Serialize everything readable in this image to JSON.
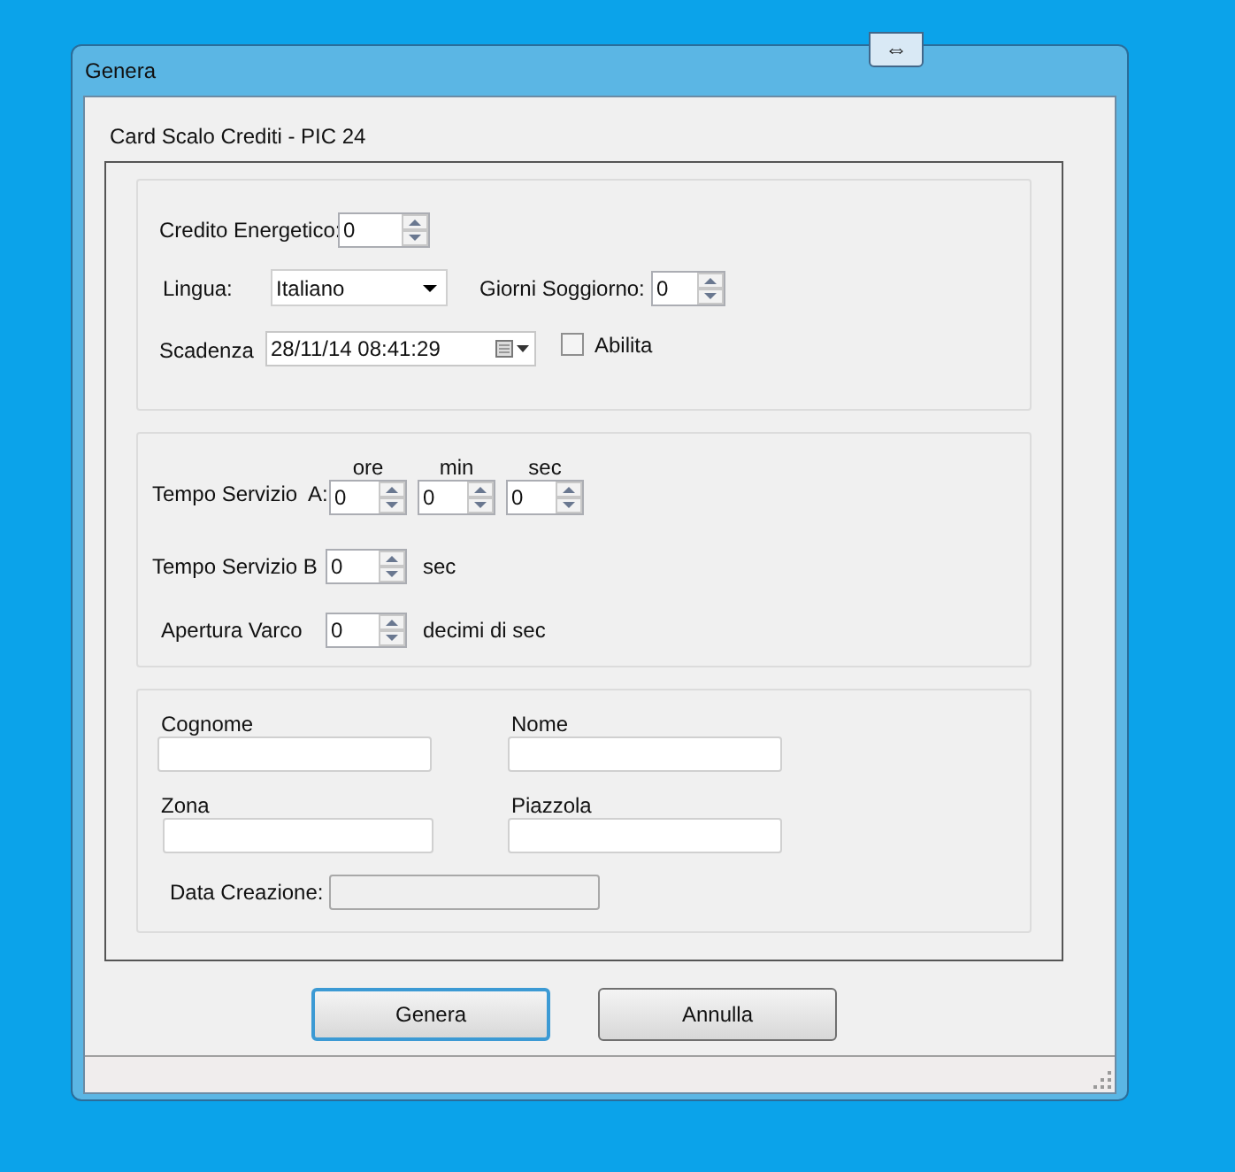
{
  "window": {
    "title": "Genera",
    "title_button": "⇔"
  },
  "heading": "Card Scalo Crediti - PIC 24",
  "credito": {
    "label": "Credito Energetico:",
    "value": "0"
  },
  "lingua": {
    "label": "Lingua:",
    "value": "Italiano"
  },
  "giorni": {
    "label": "Giorni Soggiorno:",
    "value": "0"
  },
  "scadenza": {
    "label": "Scadenza",
    "value": "28/11/14 08:41:29"
  },
  "abilita": {
    "label": "Abilita",
    "checked": false
  },
  "tempo_a": {
    "label": "Tempo Servizio  A:",
    "fields": [
      {
        "header": "ore",
        "value": "0"
      },
      {
        "header": "min",
        "value": "0"
      },
      {
        "header": "sec",
        "value": "0"
      }
    ]
  },
  "tempo_b": {
    "label": "Tempo Servizio B",
    "value": "0",
    "unit": "sec"
  },
  "apertura": {
    "label": "Apertura Varco",
    "value": "0",
    "unit": "decimi di sec"
  },
  "persona": [
    {
      "label": "Cognome"
    },
    {
      "label": "Nome"
    },
    {
      "label": "Zona"
    },
    {
      "label": "Piazzola"
    }
  ],
  "data_creazione": {
    "label": "Data Creazione:",
    "disabled": true
  },
  "buttons": [
    {
      "label": "Genera",
      "focused": true
    },
    {
      "label": "Annulla",
      "focused": false
    }
  ]
}
